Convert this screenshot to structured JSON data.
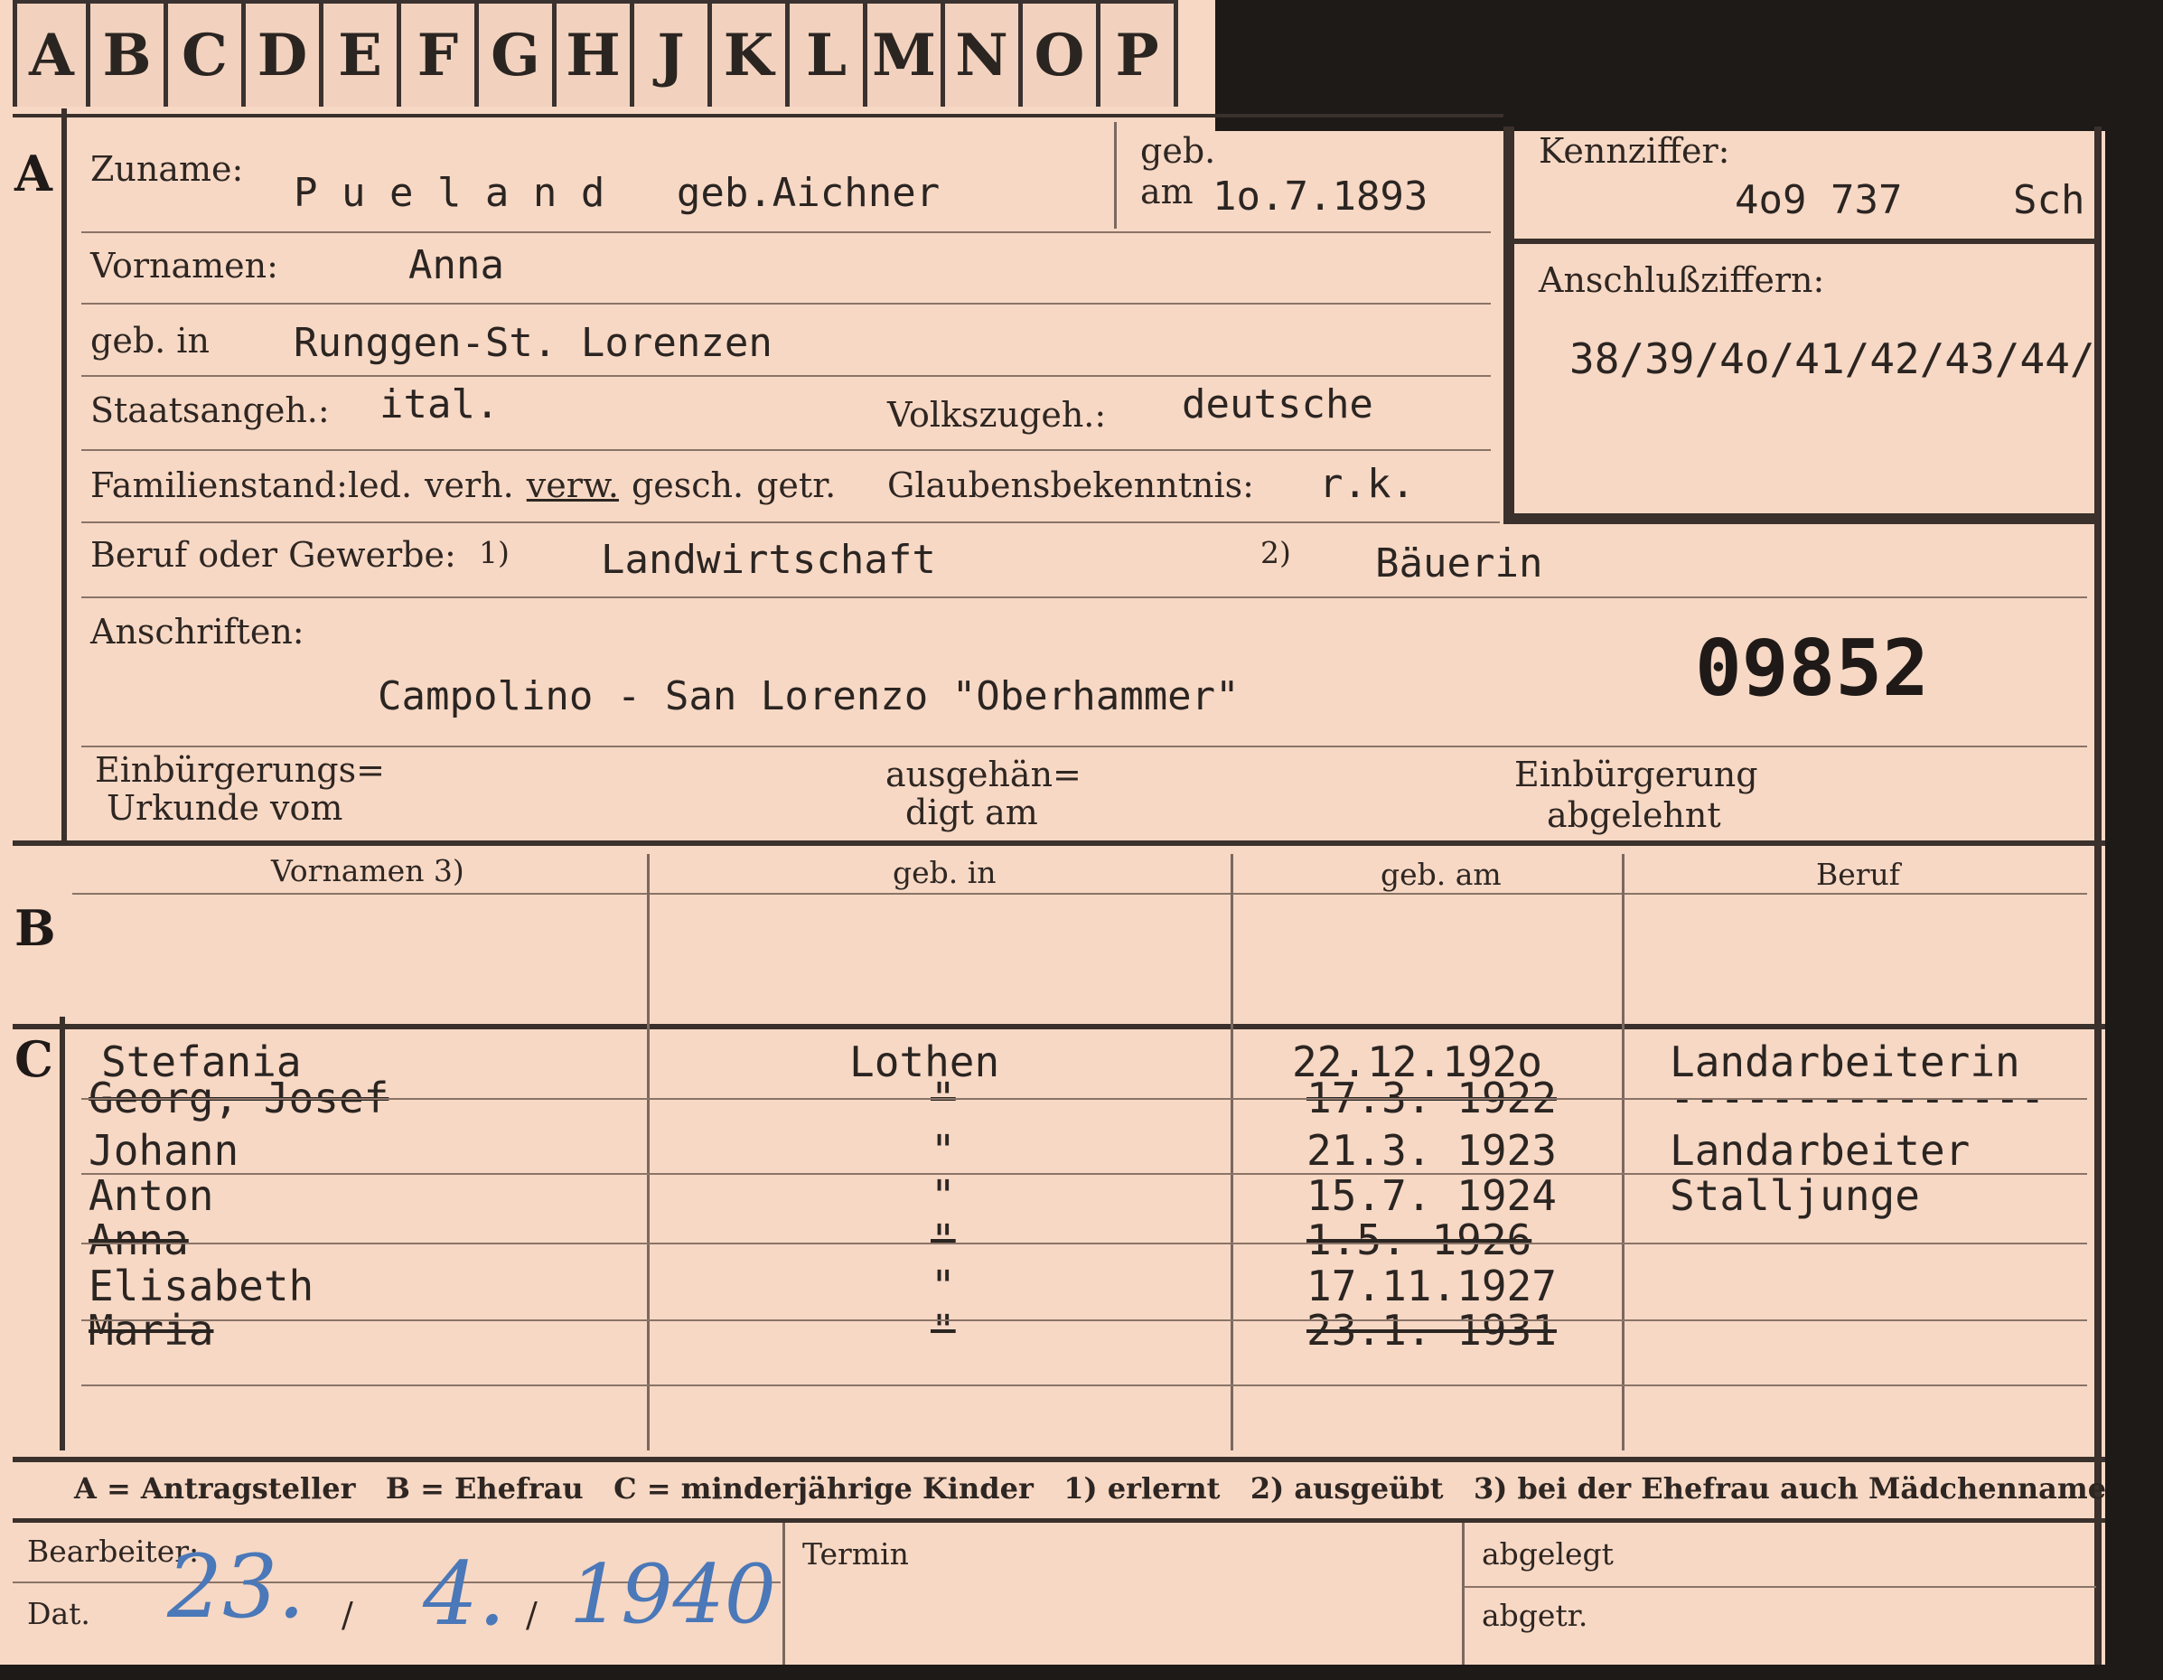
{
  "tabs": [
    "A",
    "B",
    "C",
    "D",
    "E",
    "F",
    "G",
    "H",
    "J",
    "K",
    "L",
    "M",
    "N",
    "O",
    "P"
  ],
  "section_a": {
    "marker": "A",
    "zuname_label": "Zuname:",
    "zuname": "P u e l a n d   geb.Aichner",
    "geb_label": "geb.",
    "am_label": "am",
    "geb_am": "1o.7.1893",
    "vornamen_label": "Vornamen:",
    "vornamen": "Anna",
    "geb_in_label": "geb. in",
    "geb_in": "Runggen-St. Lorenzen",
    "staatsangeh_label": "Staatsangeh.:",
    "staatsangeh": "ital.",
    "volkszugeh_label": "Volkszugeh.:",
    "volkszugeh": "deutsche",
    "familienstand_label": "Familienstand:",
    "familienstand_options": [
      "led.",
      "verh.",
      "verw.",
      "gesch.",
      "getr."
    ],
    "familienstand_selected": "verw.",
    "glauben_label": "Glaubensbekenntnis:",
    "glauben": "r.k.",
    "beruf_label": "Beruf oder Gewerbe:",
    "beruf_note1": "1)",
    "beruf1": "Landwirtschaft",
    "beruf_note2": "2)",
    "beruf2": "Bäuerin",
    "anschriften_label": "Anschriften:",
    "anschrift": "Campolino - San Lorenzo \"Oberhammer\"",
    "stamp_number": "09852",
    "einb_urkunde_label1": "Einbürgerungs=",
    "einb_urkunde_label2": "Urkunde vom",
    "ausgehaendigt_label1": "ausgehän=",
    "ausgehaendigt_label2": "digt am",
    "einb_abgelehnt_label1": "Einbürgerung",
    "einb_abgelehnt_label2": "abgelehnt"
  },
  "kennziffer": {
    "label": "Kennziffer:",
    "value": "4o9 737",
    "suffix": "Sch",
    "anschluss_label": "Anschlußziffern:",
    "anschluss_value": "38/39/4o/41/42/43/44/"
  },
  "section_b": {
    "marker": "B",
    "headers": [
      "Vornamen 3)",
      "geb. in",
      "geb. am",
      "Beruf"
    ]
  },
  "section_c": {
    "marker": "C",
    "rows": [
      {
        "name": "Stefania",
        "place": "Lothen",
        "date": "22.12.192o",
        "beruf": "Landarbeiterin",
        "struck": false
      },
      {
        "name": "Georg, Josef",
        "place": "\"",
        "date": "17.3. 1922",
        "beruf": "---------------",
        "struck": true
      },
      {
        "name": "Johann",
        "place": "\"",
        "date": "21.3. 1923",
        "beruf": "Landarbeiter",
        "struck": false
      },
      {
        "name": "Anton",
        "place": "\"",
        "date": "15.7. 1924",
        "beruf": "Stalljunge",
        "struck": false
      },
      {
        "name": "Anna",
        "place": "\"",
        "date": "1.5. 1926",
        "beruf": "",
        "struck": true
      },
      {
        "name": "Elisabeth",
        "place": "\"",
        "date": "17.11.1927",
        "beruf": "",
        "struck": false
      },
      {
        "name": "Maria",
        "place": "\"",
        "date": "23.1. 1931",
        "beruf": "",
        "struck": true
      }
    ]
  },
  "legend": "A = Antragsteller   B = Ehefrau   C = minderjährige Kinder   1) erlernt   2) ausgeübt   3) bei der Ehefrau auch Mädchenname",
  "footer": {
    "bearbeiter_label": "Bearbeiter:",
    "dat_label": "Dat.",
    "date_day": "23.",
    "date_month": "4.",
    "date_year": "1940",
    "date_sep": "/",
    "termin_label": "Termin",
    "abgelegt_label": "abgelegt",
    "abgetr_label": "abgetr."
  }
}
